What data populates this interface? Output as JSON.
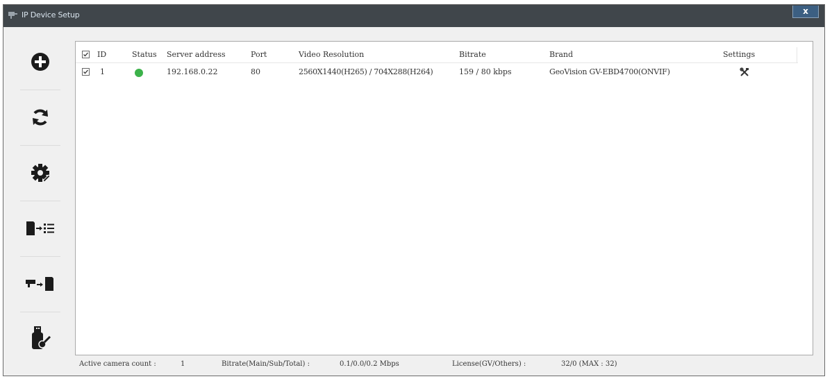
{
  "window": {
    "title": "IP Device Setup",
    "close_label": "x"
  },
  "sidebar": {
    "items": [
      {
        "icon": "add-circle-icon"
      },
      {
        "icon": "refresh-icon"
      },
      {
        "icon": "settings-gear-icon"
      },
      {
        "icon": "import-to-list-icon"
      },
      {
        "icon": "camera-to-file-icon"
      },
      {
        "icon": "usb-key-icon"
      }
    ]
  },
  "table": {
    "columns": [
      "ID",
      "Status",
      "Server address",
      "Port",
      "Video Resolution",
      "Bitrate",
      "Brand",
      "Settings"
    ],
    "rows": [
      {
        "checked": true,
        "id": "1",
        "status_color": "#3cb24a",
        "server_address": "192.168.0.22",
        "port": "80",
        "video_resolution": "2560X1440(H265) / 704X288(H264)",
        "bitrate": "159 / 80 kbps",
        "brand": "GeoVision GV-EBD4700(ONVIF)",
        "settings_icon": "settings-tools-icon"
      }
    ]
  },
  "statusbar": {
    "active_label": "Active camera count :",
    "active_value": "1",
    "bitrate_label": "Bitrate(Main/Sub/Total) :",
    "bitrate_value": "0.1/0.0/0.2 Mbps",
    "license_label": "License(GV/Others) :",
    "license_value": "32/0 (MAX : 32)"
  }
}
